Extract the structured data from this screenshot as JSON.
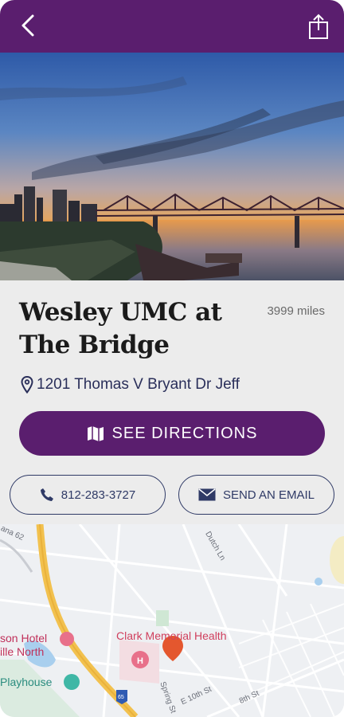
{
  "header": {
    "back_icon": "chevron-left-icon",
    "share_icon": "share-icon",
    "color": "#5a1e6e"
  },
  "hero": {
    "image": "sunset over bridge and river with city skyline"
  },
  "place": {
    "name": "Wesley UMC at The Bridge",
    "distance": "3999 miles",
    "address": "1201 Thomas V Bryant Dr Jeff"
  },
  "actions": {
    "directions_label": "SEE DIRECTIONS",
    "phone_label": "812-283-3727",
    "email_label": "SEND AN EMAIL"
  },
  "map": {
    "labels": {
      "hotel": "son Hotel",
      "hotel2": "ille North",
      "playhouse": "Playhouse",
      "clark": "Clark Memorial Health",
      "dutch": "Dutch Ln",
      "spring": "Spring St",
      "tenth": "E 10th St",
      "eighth": "8th St",
      "road62": "ana 62",
      "interstate": "65"
    }
  }
}
